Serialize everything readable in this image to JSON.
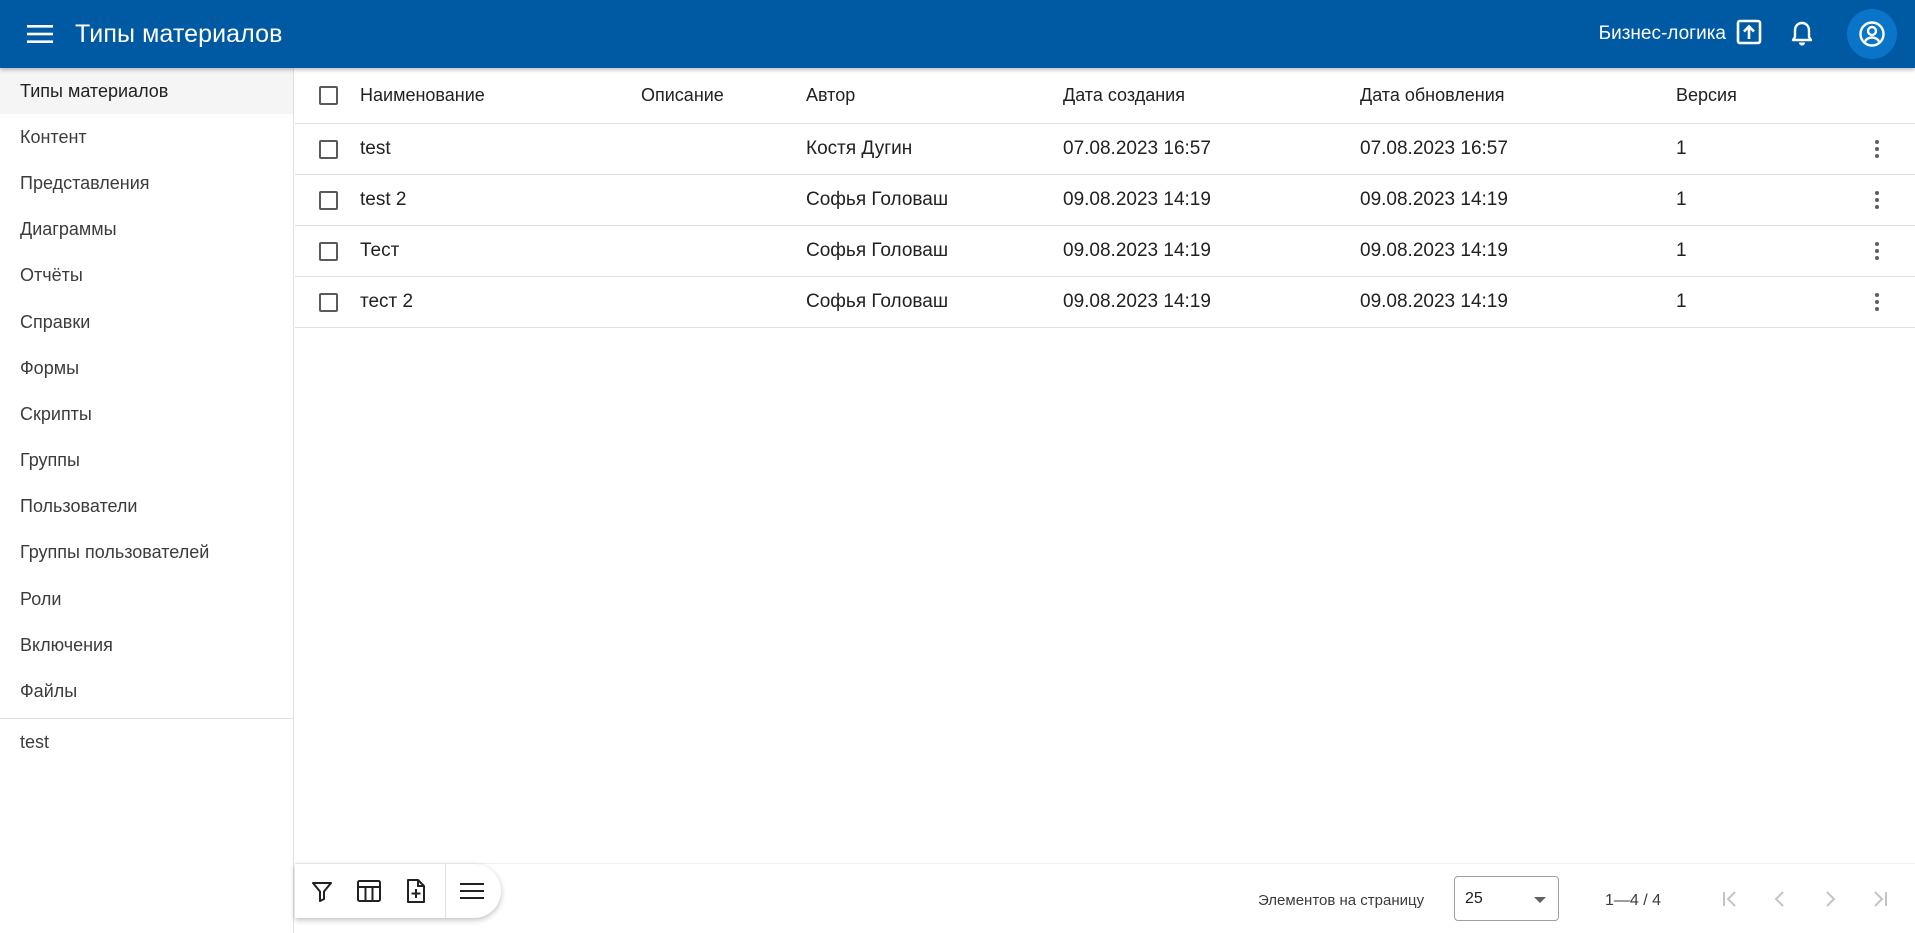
{
  "colors": {
    "accent": "#005aa3",
    "accent_2": "#0a74c8"
  },
  "header": {
    "title": "Типы материалов",
    "menu_icon": "menu-icon",
    "business_logic_label": "Бизнес-логика",
    "business_logic_icon": "upload-box-icon",
    "notifications_icon": "bell-icon",
    "account_icon": "account-circle-icon"
  },
  "sidebar": {
    "items": [
      {
        "label": "Типы материалов",
        "active": true
      },
      {
        "label": "Контент"
      },
      {
        "label": "Представления"
      },
      {
        "label": "Диаграммы"
      },
      {
        "label": "Отчёты"
      },
      {
        "label": "Справки"
      },
      {
        "label": "Формы"
      },
      {
        "label": "Скрипты"
      },
      {
        "label": "Группы"
      },
      {
        "label": "Пользователи"
      },
      {
        "label": "Группы пользователей"
      },
      {
        "label": "Роли"
      },
      {
        "label": "Включения"
      },
      {
        "label": "Файлы"
      }
    ],
    "extra_items": [
      {
        "label": "test"
      }
    ]
  },
  "table": {
    "columns": [
      "Наименование",
      "Описание",
      "Автор",
      "Дата создания",
      "Дата обновления",
      "Версия"
    ],
    "rows": [
      {
        "name": "test",
        "description": "",
        "author": "Костя Дугин",
        "created": "07.08.2023 16:57",
        "updated": "07.08.2023 16:57",
        "version": "1"
      },
      {
        "name": "test 2",
        "description": "",
        "author": "Софья Головаш",
        "created": "09.08.2023 14:19",
        "updated": "09.08.2023 14:19",
        "version": "1"
      },
      {
        "name": "Тест",
        "description": "",
        "author": "Софья Головаш",
        "created": "09.08.2023 14:19",
        "updated": "09.08.2023 14:19",
        "version": "1"
      },
      {
        "name": "тест 2",
        "description": "",
        "author": "Софья Головаш",
        "created": "09.08.2023 14:19",
        "updated": "09.08.2023 14:19",
        "version": "1"
      }
    ]
  },
  "toolbar": {
    "icons": [
      "filter-icon",
      "table-columns-icon",
      "add-file-icon",
      "list-menu-icon"
    ]
  },
  "pagination": {
    "items_per_page_label": "Элементов на страницу",
    "page_size": "25",
    "range": "1—4 / 4",
    "nav_icons": [
      "first-page-icon",
      "previous-page-icon",
      "next-page-icon",
      "last-page-icon"
    ]
  }
}
